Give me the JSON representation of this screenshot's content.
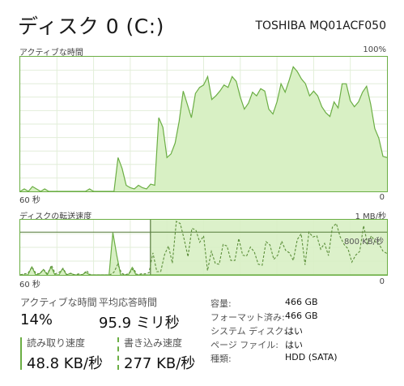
{
  "header": {
    "title": "ディスク 0 (C:)",
    "device_name": "TOSHIBA MQ01ACF050"
  },
  "active_time_graph": {
    "label": "アクティブな時間",
    "max_label": "100%",
    "time_label": "60 秒",
    "end_label": "0",
    "values": [
      0,
      2,
      0,
      4,
      2,
      0,
      2,
      0,
      0,
      0,
      0,
      0,
      0,
      0,
      0,
      0,
      0,
      2,
      0,
      0,
      0,
      0,
      0,
      0,
      28,
      19,
      5,
      3,
      2,
      5,
      3,
      2,
      6,
      5,
      61,
      53,
      28,
      31,
      40,
      58,
      83,
      72,
      61,
      81,
      86,
      88,
      95,
      76,
      79,
      83,
      88,
      86,
      95,
      91,
      78,
      68,
      73,
      82,
      79,
      85,
      83,
      68,
      64,
      74,
      89,
      82,
      92,
      103,
      99,
      93,
      89,
      79,
      83,
      79,
      70,
      65,
      62,
      74,
      69,
      89,
      89,
      75,
      70,
      74,
      82,
      87,
      72,
      52,
      44,
      29,
      28
    ]
  },
  "transfer_graph": {
    "label": "ディスクの転送速度",
    "max_label": "1 MB/秒",
    "marker_label": "800 KB/秒",
    "time_label": "60 秒",
    "end_label": "0",
    "read_values_pct": [
      0,
      0,
      0,
      15,
      0,
      2,
      10,
      0,
      15,
      0,
      0,
      12,
      0,
      3,
      0,
      0,
      0,
      5,
      0,
      0,
      0,
      0,
      0,
      0,
      79,
      37,
      0,
      0,
      0,
      14,
      0,
      0,
      0,
      0,
      0,
      0,
      0,
      0,
      0,
      0,
      0,
      0,
      0,
      0,
      0,
      0,
      0,
      0,
      0,
      0,
      0,
      0,
      0,
      0,
      0,
      0,
      0,
      0,
      0,
      0,
      0,
      0,
      0,
      0,
      0,
      0,
      0,
      0,
      0,
      0,
      0,
      0,
      0,
      0,
      0,
      0,
      0,
      0,
      0,
      0,
      0,
      0,
      0,
      0,
      0,
      0,
      0,
      0,
      0,
      0,
      0,
      0,
      0,
      0,
      0,
      0
    ],
    "write_values_pct": [
      0,
      2,
      3,
      15,
      3,
      2,
      10,
      2,
      18,
      2,
      5,
      12,
      0,
      3,
      0,
      2,
      0,
      8,
      0,
      0,
      0,
      0,
      0,
      0,
      5,
      20,
      3,
      0,
      4,
      12,
      0,
      2,
      2,
      4,
      41,
      6,
      6,
      38,
      54,
      22,
      100,
      96,
      67,
      34,
      87,
      84,
      61,
      73,
      8,
      44,
      21,
      20,
      57,
      54,
      27,
      27,
      68,
      37,
      35,
      52,
      43,
      20,
      18,
      62,
      56,
      29,
      37,
      63,
      46,
      41,
      27,
      66,
      77,
      19,
      80,
      71,
      73,
      48,
      59,
      36,
      89,
      96,
      71,
      57,
      49,
      24,
      37,
      44,
      92,
      58,
      73,
      62,
      57,
      44,
      40
    ]
  },
  "stats": {
    "active_time": {
      "label": "アクティブな時間",
      "value": "14%"
    },
    "avg_response": {
      "label": "平均応答時間",
      "value": "95.9 ミリ秒"
    },
    "read_speed": {
      "label": "読み取り速度",
      "value": "48.8 KB/秒"
    },
    "write_speed": {
      "label": "書き込み速度",
      "value": "277 KB/秒"
    }
  },
  "properties": [
    {
      "label": "容量:",
      "value": "466 GB"
    },
    {
      "label": "フォーマット済み:",
      "value": "466 GB"
    },
    {
      "label": "システム ディスク:",
      "value": "はい"
    },
    {
      "label": "ページ ファイル:",
      "value": "はい"
    },
    {
      "label": "種類:",
      "value": "HDD (SATA)"
    }
  ],
  "colors": {
    "accent": "#6bae44",
    "fill": "#d8f0c4",
    "grid": "#e2eed9"
  }
}
